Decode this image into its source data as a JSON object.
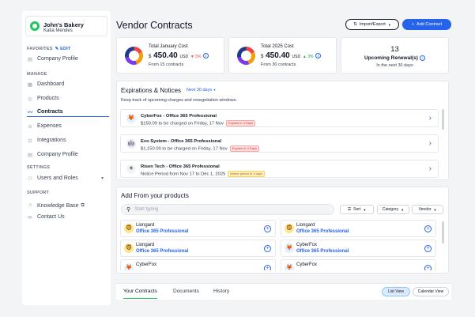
{
  "sidebar": {
    "org_name": "John's Bakery",
    "org_user": "Katia Mendes",
    "favorites_label": "FAVORITES",
    "edit_label": "EDIT",
    "favorites": [
      {
        "label": "Company Profile",
        "icon": "building-icon"
      }
    ],
    "manage_label": "MANAGE",
    "manage": [
      {
        "label": "Dashboard",
        "icon": "grid-icon"
      },
      {
        "label": "Products",
        "icon": "box-icon"
      },
      {
        "label": "Contracts",
        "icon": "contract-icon",
        "active": true
      },
      {
        "label": "Expenses",
        "icon": "wallet-icon"
      },
      {
        "label": "Integrations",
        "icon": "plug-icon"
      },
      {
        "label": "Company Profile",
        "icon": "building-icon"
      }
    ],
    "settings_label": "SETTINGS",
    "settings": [
      {
        "label": "Users and Roles",
        "icon": "users-icon"
      }
    ],
    "support_label": "SUPPORT",
    "support": [
      {
        "label": "Knowledge Base",
        "icon": "help-icon"
      },
      {
        "label": "Contact Us",
        "icon": "mail-icon"
      }
    ]
  },
  "header": {
    "title": "Vendor Contracts",
    "import_export_label": "Import/Export",
    "add_contract_label": "Add Contract"
  },
  "kpis": {
    "jan": {
      "label": "Total January Cost",
      "currency": "$",
      "value": "450.40",
      "unit": "USD",
      "change": "5%",
      "change_dir": "down",
      "foot": "From 15 contracts"
    },
    "y2025": {
      "label": "Total 2025 Cost",
      "currency": "$",
      "value": "450.40",
      "unit": "USD",
      "change": "3%",
      "change_dir": "up",
      "foot": "From 30 contracts"
    },
    "renewals": {
      "count": "13",
      "label": "Upcoming Renewal(s)",
      "foot": "In the next 30 days"
    }
  },
  "expirations": {
    "title": "Expirations & Notices",
    "range_label": "Next 30 days",
    "subtitle": "Keep track of upcoming charges and renegotiation windows.",
    "items": [
      {
        "title": "CyberFox - Office 365 Professional",
        "detail": "$150.00 to be charged on Friday, 17 Nov",
        "badge": "Expires in 3 Days",
        "badge_type": "red"
      },
      {
        "title": "Evo System - Office 365 Professional",
        "detail": "$1,150.00 to be charged on  Friday, 17 Nov",
        "badge": "Expires in 3 Days",
        "badge_type": "red"
      },
      {
        "title": "Risen Tech - Office 365 Professional",
        "detail": "Notice Period from Nov 17 to Dec 1, 2025",
        "badge": "Notice period in 3 days",
        "badge_type": "amber"
      }
    ]
  },
  "products": {
    "title": "Add From your products",
    "search_placeholder": "Start typing",
    "sort_label": "Sort",
    "category_label": "Category",
    "vendor_label": "Vendor",
    "items": [
      {
        "vendor": "Liongard",
        "product": "Office 365 Professional"
      },
      {
        "vendor": "Liongard",
        "product": "Office 365 Professional"
      },
      {
        "vendor": "Liongard",
        "product": "Office 365 Professional"
      },
      {
        "vendor": "CyberFox",
        "product": "Office 365 Professional"
      },
      {
        "vendor": "CyberFox",
        "product": ""
      },
      {
        "vendor": "CyberFox",
        "product": ""
      }
    ]
  },
  "tabs": {
    "items": [
      "Your Contracts",
      "Documents",
      "History"
    ],
    "list_view": "List View",
    "calendar_view": "Calendar View"
  }
}
